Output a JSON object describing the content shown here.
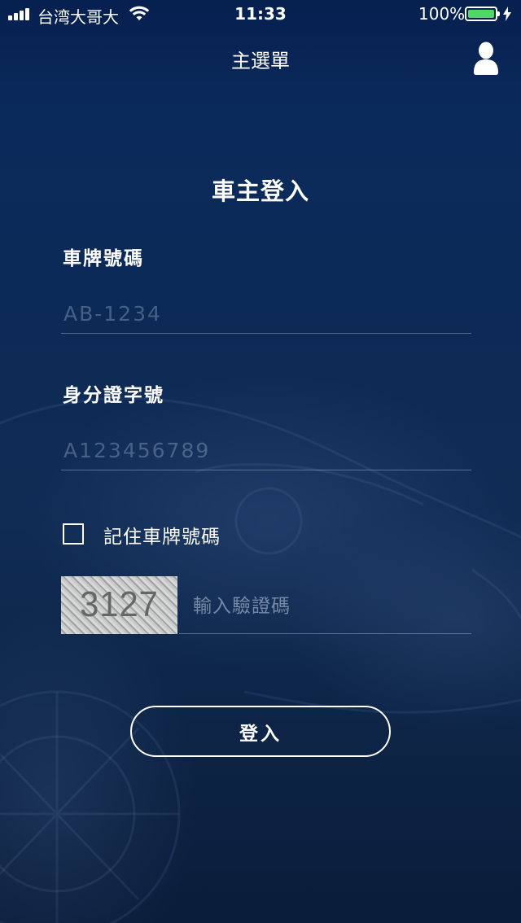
{
  "status_bar": {
    "carrier": "台湾大哥大",
    "time": "11:33",
    "battery": "100%",
    "icons": [
      "signal-icon",
      "wifi-icon",
      "battery-icon",
      "charging-icon"
    ]
  },
  "nav": {
    "title": "主選單",
    "user_icon": "user-icon"
  },
  "form": {
    "heading": "車主登入",
    "plate": {
      "label": "車牌號碼",
      "value": "",
      "placeholder": "AB-1234"
    },
    "id_number": {
      "label": "身分證字號",
      "value": "",
      "placeholder": "A123456789"
    },
    "remember": {
      "label": "記住車牌號碼",
      "checked": false
    },
    "captcha": {
      "code": "3127",
      "value": "",
      "placeholder": "輸入驗證碼"
    },
    "submit_label": "登入"
  },
  "colors": {
    "background": "#0b2248",
    "text": "#ffffff",
    "battery_fill": "#4cd964"
  }
}
